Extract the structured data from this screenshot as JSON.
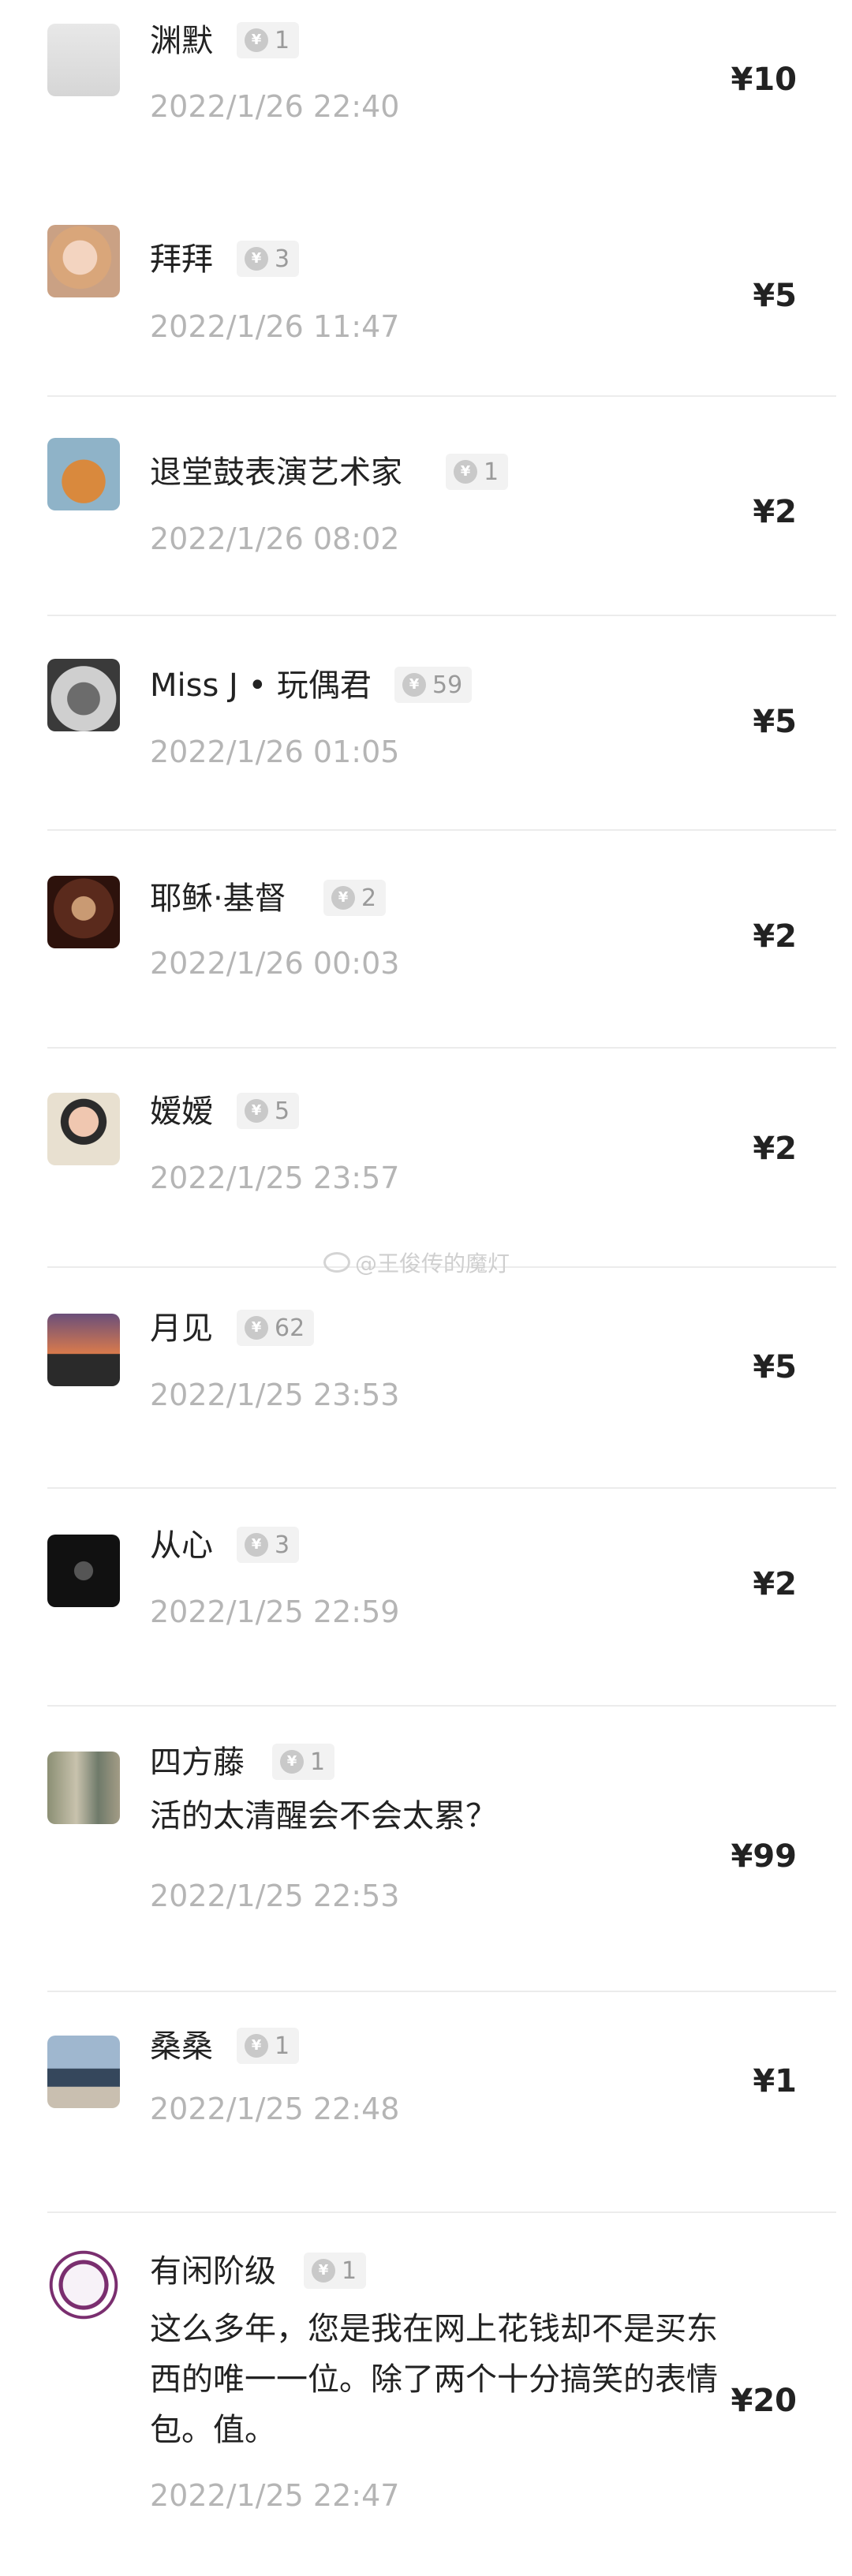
{
  "donations": [
    {
      "name": "渊默",
      "count": "1",
      "time": "2022/1/26 22:40",
      "amount": "¥10",
      "message": "",
      "avatar": "avatar-sketch"
    },
    {
      "name": "拜拜",
      "count": "3",
      "time": "2022/1/26 11:47",
      "amount": "¥5",
      "message": "",
      "avatar": "avatar-girl"
    },
    {
      "name": "退堂鼓表演艺术家",
      "count": "1",
      "time": "2022/1/26 08:02",
      "amount": "¥2",
      "message": "",
      "avatar": "avatar-cat"
    },
    {
      "name": "Miss J • 玩偶君",
      "count": "59",
      "time": "2022/1/26 01:05",
      "amount": "¥5",
      "message": "",
      "avatar": "avatar-bw-photo"
    },
    {
      "name": "耶稣·基督",
      "count": "2",
      "time": "2022/1/26 00:03",
      "amount": "¥2",
      "message": "",
      "avatar": "avatar-portrait"
    },
    {
      "name": "嫒嫒",
      "count": "5",
      "time": "2022/1/25 23:57",
      "amount": "¥2",
      "message": "",
      "avatar": "avatar-child"
    },
    {
      "name": "月见",
      "count": "62",
      "time": "2022/1/25 23:53",
      "amount": "¥5",
      "message": "",
      "avatar": "avatar-sunset"
    },
    {
      "name": "从心",
      "count": "3",
      "time": "2022/1/25 22:59",
      "amount": "¥2",
      "message": "",
      "avatar": "avatar-dark"
    },
    {
      "name": "四方藤",
      "count": "1",
      "time": "2022/1/25 22:53",
      "amount": "¥99",
      "message": "活的太清醒会不会太累？",
      "avatar": "avatar-bottles"
    },
    {
      "name": "桑桑",
      "count": "1",
      "time": "2022/1/25 22:48",
      "amount": "¥1",
      "message": "",
      "avatar": "avatar-beach"
    },
    {
      "name": "有闲阶级",
      "count": "1",
      "time": "2022/1/25 22:47",
      "amount": "¥20",
      "message": "这么多年，您是我在网上花钱却不是买东西的唯一一位。除了两个十分搞笑的表情包。值。",
      "avatar": "avatar-seal"
    }
  ],
  "coin_glyph": "¥",
  "watermark": "@王俊传的魔灯",
  "colors": {
    "name": "#222222",
    "time": "#b5b5b5",
    "badge_bg": "#f2f2f2",
    "separator": "#ececec"
  }
}
